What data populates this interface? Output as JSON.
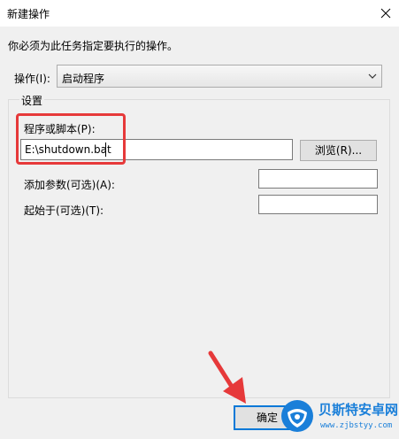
{
  "window": {
    "title": "新建操作"
  },
  "dialog": {
    "description": "你必须为此任务指定要执行的操作。",
    "action_label": "操作(I):",
    "action_value": "启动程序",
    "settings_label": "设置",
    "program_label": "程序或脚本(P):",
    "program_value": "E:\\shutdown.bat",
    "browse_label": "浏览(R)...",
    "args_label": "添加参数(可选)(A):",
    "args_value": "",
    "start_in_label": "起始于(可选)(T):",
    "start_in_value": "",
    "ok_label": "确定"
  },
  "annotations": {
    "highlight_color": "#e6393a",
    "arrow_color": "#e6393a"
  },
  "watermark": {
    "name": "贝斯特安卓网",
    "url": "www.zjbstyy.com"
  }
}
